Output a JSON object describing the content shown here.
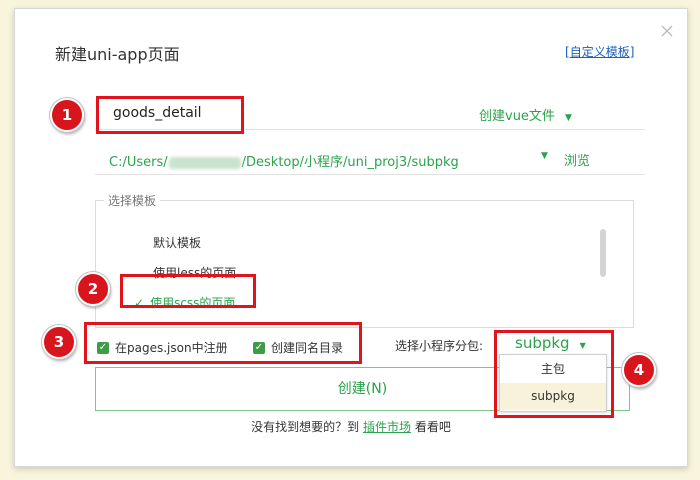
{
  "dialog": {
    "title": "新建uni-app页面",
    "custom_template_link": "自定义模板",
    "link_bracket_open": "[",
    "link_bracket_close": "]"
  },
  "page_name": {
    "value": "goods_detail"
  },
  "create_type": {
    "label": "创建vue文件",
    "icon": "caret-down-icon"
  },
  "path": {
    "prefix": "C:/Users/",
    "suffix": "/Desktop/小程序/uni_proj3/subpkg",
    "browse_label": "浏览"
  },
  "template_group": {
    "legend": "选择模板",
    "items": [
      {
        "label": "默认模板",
        "selected": false
      },
      {
        "label": "使用less的页面",
        "selected": false
      },
      {
        "label": "使用scss的页面",
        "selected": true
      }
    ]
  },
  "options": {
    "register_label": "在pages.json中注册",
    "register_checked": true,
    "same_dir_label": "创建同名目录",
    "same_dir_checked": true,
    "subpackage_label": "选择小程序分包:",
    "subpackage_value": "subpkg",
    "subpackage_options": [
      "主包",
      "subpkg"
    ]
  },
  "create_button": {
    "label": "创建(N)"
  },
  "footer": {
    "prefix": "没有找到想要的？到",
    "link": "插件市场",
    "suffix": "看看吧"
  },
  "annotations": [
    "1",
    "2",
    "3",
    "4"
  ],
  "colors": {
    "accent": "#2ba24c",
    "annotation": "#d8141c",
    "link": "#1b5fb8"
  }
}
